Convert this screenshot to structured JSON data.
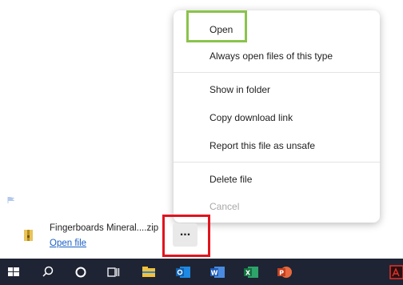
{
  "context_menu": {
    "items": [
      {
        "label": "Open"
      },
      {
        "label": "Always open files of this type"
      },
      {
        "label": "Show in folder"
      },
      {
        "label": "Copy download link"
      },
      {
        "label": "Report this file as unsafe"
      },
      {
        "label": "Delete file"
      },
      {
        "label": "Cancel",
        "disabled": true
      }
    ]
  },
  "download": {
    "file_name": "Fingerboards Mineral....zip",
    "action": "Open file",
    "more_label": "..."
  },
  "taskbar": {
    "icons": [
      "windows-start-icon",
      "search-icon",
      "cortana-icon",
      "task-view-icon",
      "file-explorer-icon",
      "outlook-icon",
      "word-icon",
      "excel-icon",
      "powerpoint-icon",
      "acrobat-icon"
    ]
  },
  "colors": {
    "highlight_green": "#8bc34a",
    "highlight_red": "#e0141e",
    "taskbar_bg": "#1e2433",
    "link_blue": "#1a5fc4"
  }
}
